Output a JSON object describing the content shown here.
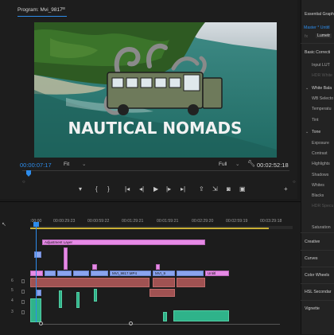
{
  "monitor": {
    "title": "Program: Mvi_9817",
    "menu_icon": "hamburger-icon",
    "current_timecode": "00:00:07:17",
    "fit_label": "Fit",
    "quality_label": "Full",
    "duration_timecode": "00:02:52:18",
    "video_title_text": "NAUTICAL NOMADS",
    "transport": {
      "icons": [
        "marker-icon",
        "in-point-icon",
        "out-point-icon",
        "go-to-in-icon",
        "step-back-icon",
        "play-icon",
        "step-forward-icon",
        "go-to-out-icon",
        "lift-icon",
        "extract-icon",
        "export-frame-icon",
        "compare-icon",
        "add-icon"
      ]
    }
  },
  "essential_graphics": {
    "header": "Essential Graph",
    "source_label": "Master * Untitl",
    "lumetri_tab": "Lumetr",
    "basic_correction": "Basic Correcti",
    "input_lut": "Input LUT",
    "hdr_white": "HDR White",
    "white_balance": "White Bala",
    "wb_selector": "WB Selecto",
    "temperature": "Temperatu",
    "tint": "Tint",
    "tone": "Tone",
    "exposure": "Exposure",
    "contrast": "Contrast",
    "highlights": "Highlights",
    "shadows": "Shadows",
    "whites": "Whites",
    "blacks": "Blacks",
    "hdr_specular": "HDR Specu",
    "saturation": "Saturation",
    "creative": "Creative",
    "curves": "Curves",
    "color_wheels": "Color Wheels",
    "hsl_secondary": "HSL Secondar",
    "vignette": "Vignette"
  },
  "timeline": {
    "ruler_labels": [
      ":00:00",
      "00:00:29:23",
      "00:00:59:22",
      "00:01:29:21",
      "00:01:59:21",
      "00:02:29:20",
      "00:02:59:19",
      "00:03:29:18"
    ],
    "clips": {
      "adjustment_layer": "Adjustment Layer",
      "mvi_a": "MVI_9817.MP4",
      "mvi_b": "MVI_9",
      "mvi_short": "MVI",
      "untitled": "Untitl"
    },
    "track_labels": [
      "6",
      "5",
      "4",
      "3"
    ]
  },
  "colors": {
    "accent_blue": "#2d8ceb",
    "clip_pink": "#e68ae6",
    "clip_blue": "#8aa4ee",
    "clip_red": "#a05252",
    "clip_green": "#2fb38a",
    "work_area_yellow": "#c9b035"
  }
}
